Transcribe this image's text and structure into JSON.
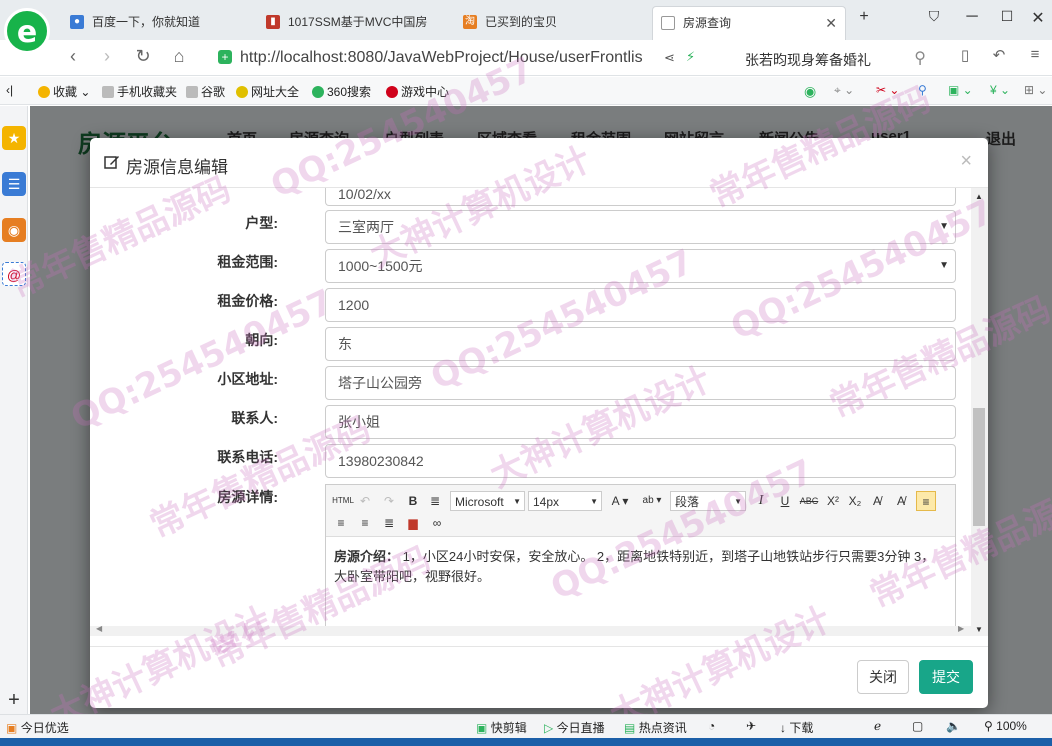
{
  "browser": {
    "logo": "e",
    "tabs": [
      {
        "label": "百度一下，你就知道",
        "icon_color": "#3a7bd5",
        "icon": "paw-icon"
      },
      {
        "label": "1017SSM基于MVC中国房",
        "icon_color": "#c0392b",
        "icon": "doc-icon"
      },
      {
        "label": "已买到的宝贝",
        "icon_color": "#e67e22",
        "icon": "taobao-icon",
        "icon_text": "淘"
      },
      {
        "label": "房源查询",
        "icon_color": "#999999",
        "icon": "page-icon",
        "active": true
      }
    ],
    "new_tab": "+",
    "url": "http://localhost:8080/JavaWebProject/House/userFrontlis",
    "news_ticker": "张若昀现身筹备婚礼",
    "bookmarks": [
      {
        "label": "收藏",
        "color": "#f4b400"
      },
      {
        "label": "手机收藏夹",
        "color": "#888888"
      },
      {
        "label": "谷歌",
        "color": "#888888"
      },
      {
        "label": "网址大全",
        "color": "#e0c000"
      },
      {
        "label": "360搜索",
        "color": "#2db35d"
      },
      {
        "label": "游戏中心",
        "color": "#d0021b"
      }
    ]
  },
  "page_bg": {
    "brand": "房源平台",
    "nav": [
      "首页",
      "房源查询",
      "户型列表",
      "区域查看",
      "租金范围",
      "网站留言",
      "新闻公告",
      "user1",
      "退出"
    ]
  },
  "modal": {
    "title": "房源信息编辑",
    "close": "×",
    "partial_value": "10/02/xx",
    "fields": [
      {
        "label": "户型:",
        "value": "三室两厅",
        "type": "select"
      },
      {
        "label": "租金范围:",
        "value": "1000~1500元",
        "type": "select"
      },
      {
        "label": "租金价格:",
        "value": "1200",
        "type": "input"
      },
      {
        "label": "朝向:",
        "value": "东",
        "type": "input"
      },
      {
        "label": "小区地址:",
        "value": "塔子山公园旁",
        "type": "input"
      },
      {
        "label": "联系人:",
        "value": "张小姐",
        "type": "input"
      },
      {
        "label": "联系电话:",
        "value": "13980230842",
        "type": "input"
      }
    ],
    "detail_label": "房源详情:",
    "editor": {
      "html": "HTML",
      "font": "Microsoft",
      "size": "14px",
      "paragraph": "段落",
      "content_bold": "房源介绍：",
      "content": " 1，小区24小时安保，安全放心。 2，距离地铁特别近，到塔子山地铁站步行只需要3分钟 3，大卧室带阳吧，视野很好。"
    },
    "buttons": {
      "close": "关闭",
      "submit": "提交"
    }
  },
  "statusbar": {
    "left": "今日优选",
    "items": [
      "快剪辑",
      "今日直播",
      "热点资讯",
      "下载",
      "100%"
    ]
  },
  "watermark": {
    "lines": [
      "常年售精品源码",
      "QQ:254540457",
      "大神计算机设计"
    ]
  }
}
